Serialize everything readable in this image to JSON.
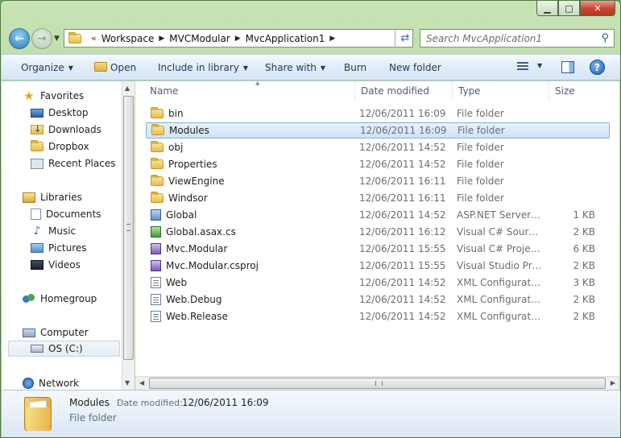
{
  "window": {
    "caption": {
      "minimize": "▁",
      "maximize": "□",
      "close": "✕"
    }
  },
  "address": {
    "overflow": "«",
    "crumbs": [
      "Workspace",
      "MVCModular",
      "MvcApplication1"
    ]
  },
  "search": {
    "placeholder": "Search MvcApplication1"
  },
  "toolbar": {
    "organize": "Organize",
    "open": "Open",
    "include": "Include in library",
    "share": "Share with",
    "burn": "Burn",
    "new_folder": "New folder"
  },
  "nav": {
    "favorites": "Favorites",
    "desktop": "Desktop",
    "downloads": "Downloads",
    "dropbox": "Dropbox",
    "recent": "Recent Places",
    "libraries": "Libraries",
    "documents": "Documents",
    "music": "Music",
    "pictures": "Pictures",
    "videos": "Videos",
    "homegroup": "Homegroup",
    "computer": "Computer",
    "os": "OS (C:)",
    "network": "Network"
  },
  "columns": {
    "name": "Name",
    "date": "Date modified",
    "type": "Type",
    "size": "Size"
  },
  "files": [
    {
      "name": "bin",
      "date": "12/06/2011 16:09",
      "type": "File folder",
      "size": "",
      "icon": "folder"
    },
    {
      "name": "Modules",
      "date": "12/06/2011 16:09",
      "type": "File folder",
      "size": "",
      "icon": "folder"
    },
    {
      "name": "obj",
      "date": "12/06/2011 14:52",
      "type": "File folder",
      "size": "",
      "icon": "folder"
    },
    {
      "name": "Properties",
      "date": "12/06/2011 14:52",
      "type": "File folder",
      "size": "",
      "icon": "folder"
    },
    {
      "name": "ViewEngine",
      "date": "12/06/2011 16:11",
      "type": "File folder",
      "size": "",
      "icon": "folder"
    },
    {
      "name": "Windsor",
      "date": "12/06/2011 16:11",
      "type": "File folder",
      "size": "",
      "icon": "folder"
    },
    {
      "name": "Global",
      "date": "12/06/2011 14:52",
      "type": "ASP.NET Server A...",
      "size": "1 KB",
      "icon": "aspx"
    },
    {
      "name": "Global.asax.cs",
      "date": "12/06/2011 16:12",
      "type": "Visual C# Source f...",
      "size": "2 KB",
      "icon": "cs"
    },
    {
      "name": "Mvc.Modular",
      "date": "12/06/2011 15:55",
      "type": "Visual C# Project f...",
      "size": "6 KB",
      "icon": "proj"
    },
    {
      "name": "Mvc.Modular.csproj",
      "date": "12/06/2011 15:55",
      "type": "Visual Studio Proj...",
      "size": "2 KB",
      "icon": "proj"
    },
    {
      "name": "Web",
      "date": "12/06/2011 14:52",
      "type": "XML Configuratio...",
      "size": "3 KB",
      "icon": "config"
    },
    {
      "name": "Web.Debug",
      "date": "12/06/2011 14:52",
      "type": "XML Configuratio...",
      "size": "2 KB",
      "icon": "config"
    },
    {
      "name": "Web.Release",
      "date": "12/06/2011 14:52",
      "type": "XML Configuratio...",
      "size": "2 KB",
      "icon": "config"
    }
  ],
  "details": {
    "name": "Modules",
    "date_label": "Date modified:",
    "date_value": "12/06/2011 16:09",
    "type": "File folder"
  }
}
